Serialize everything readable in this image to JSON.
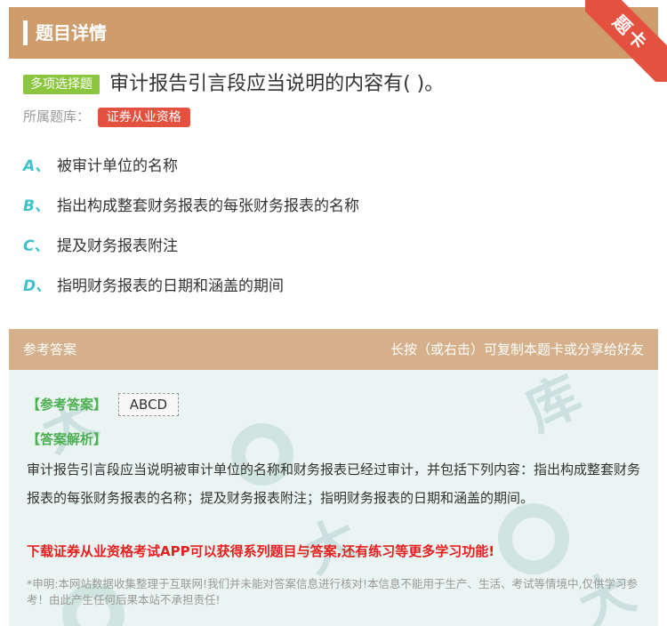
{
  "header": {
    "title": "题目详情",
    "ribbon": "题卡"
  },
  "question": {
    "type": "多项选择题",
    "text": "审计报告引言段应当说明的内容有( )。",
    "library_label": "所属题库：",
    "library": "证券从业资格"
  },
  "options": [
    {
      "letter": "A、",
      "text": "被审计单位的名称"
    },
    {
      "letter": "B、",
      "text": "指出构成整套财务报表的每张财务报表的名称"
    },
    {
      "letter": "C、",
      "text": "提及财务报表附注"
    },
    {
      "letter": "D、",
      "text": "指明财务报表的日期和涵盖的期间"
    }
  ],
  "answer_section": {
    "title": "参考答案",
    "hint": "长按（或右击）可复制本题卡或分享给好友",
    "answer_label": "【参考答案】",
    "answer": "ABCD",
    "analysis_label": "【答案解析】",
    "analysis": "审计报告引言段应当说明被审计单位的名称和财务报表已经过审计，并包括下列内容：指出构成整套财务报表的每张财务报表的名称；提及财务报表附注；指明财务报表的日期和涵盖的期间。",
    "download": "下载证券从业资格考试APP可以获得系列题目与答案,还有练习等更多学习功能!",
    "disclaimer": "*申明:本网站数据收集整理于互联网!我们并未能对答案信息进行核对!本信息不能用于生产、生活、考试等情境中,仅供学习参考！由此产生任何后果本站不承担责任!"
  },
  "colors": {
    "header_bg": "#cf9d6b",
    "answer_header_bg": "#d6b08a",
    "answer_body_bg": "#eaf5f3",
    "ribbon": "#e5513f",
    "qtype_tag": "#8cc63f",
    "option_letter": "#3fc1c9",
    "answer_label": "#4caf50",
    "download_text": "#e5201f"
  }
}
